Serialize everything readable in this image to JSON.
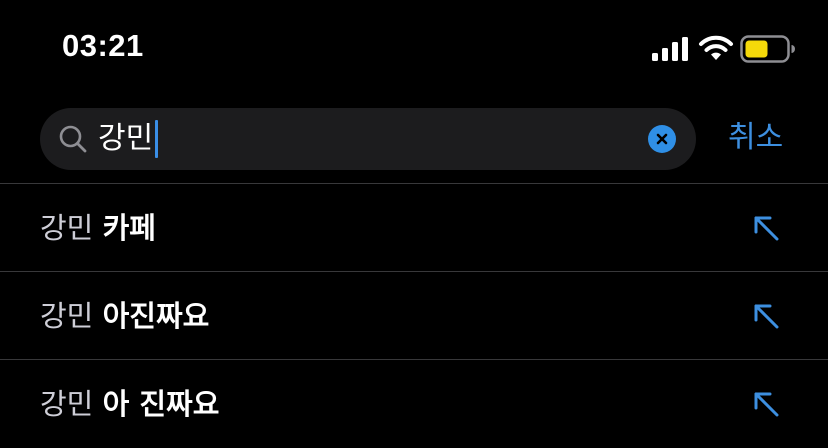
{
  "status_bar": {
    "time": "03:21"
  },
  "search": {
    "value": "강민",
    "cancel_label": "취소"
  },
  "suggestions": [
    {
      "query": "강민",
      "completion": "카페"
    },
    {
      "query": "강민",
      "completion": "아진짜요"
    },
    {
      "query": "강민",
      "completion": "아 진짜요"
    }
  ],
  "icons": {
    "search": "search-icon",
    "clear": "clear-icon",
    "fill_arrow": "arrow-up-left-icon",
    "signal": "cellular-signal-icon",
    "wifi": "wifi-icon",
    "battery": "battery-icon"
  },
  "colors": {
    "accent": "#3d8fe0",
    "battery_fill": "#f5d90a",
    "field_background": "#1c1c1e"
  }
}
